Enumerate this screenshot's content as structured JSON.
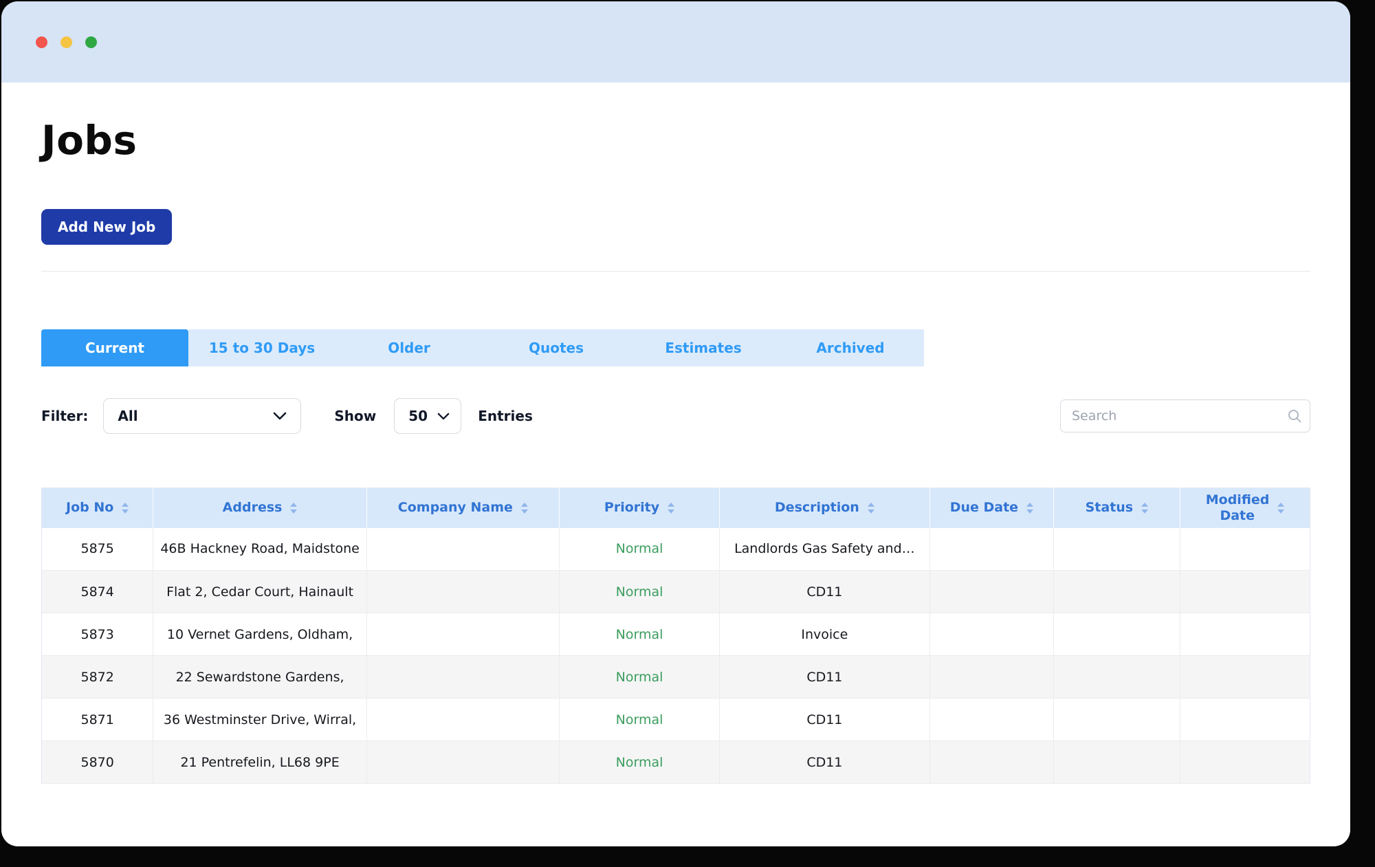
{
  "page": {
    "title": "Jobs",
    "add_button_label": "Add New Job"
  },
  "tabs": [
    {
      "label": "Current",
      "active": true
    },
    {
      "label": "15 to 30 Days",
      "active": false
    },
    {
      "label": "Older",
      "active": false
    },
    {
      "label": "Quotes",
      "active": false
    },
    {
      "label": "Estimates",
      "active": false
    },
    {
      "label": "Archived",
      "active": false
    }
  ],
  "filters": {
    "filter_label": "Filter:",
    "filter_value": "All",
    "show_label": "Show",
    "show_value": "50",
    "entries_label": "Entries",
    "search_placeholder": "Search"
  },
  "table": {
    "columns": [
      "Job No",
      "Address",
      "Company Name",
      "Priority",
      "Description",
      "Due Date",
      "Status",
      "Modified Date"
    ],
    "rows": [
      {
        "job_no": "5875",
        "address": "46B Hackney Road, Maidstone",
        "company": "",
        "priority": "Normal",
        "description": "Landlords Gas Safety and…",
        "due_date": "",
        "status": "",
        "modified": ""
      },
      {
        "job_no": "5874",
        "address": "Flat 2, Cedar Court, Hainault",
        "company": "",
        "priority": "Normal",
        "description": "CD11",
        "due_date": "",
        "status": "",
        "modified": ""
      },
      {
        "job_no": "5873",
        "address": "10 Vernet Gardens, Oldham,",
        "company": "",
        "priority": "Normal",
        "description": "Invoice",
        "due_date": "",
        "status": "",
        "modified": ""
      },
      {
        "job_no": "5872",
        "address": "22 Sewardstone Gardens,",
        "company": "",
        "priority": "Normal",
        "description": "CD11",
        "due_date": "",
        "status": "",
        "modified": ""
      },
      {
        "job_no": "5871",
        "address": "36 Westminster Drive, Wirral,",
        "company": "",
        "priority": "Normal",
        "description": "CD11",
        "due_date": "",
        "status": "",
        "modified": ""
      },
      {
        "job_no": "5870",
        "address": "21 Pentrefelin, LL68 9PE",
        "company": "",
        "priority": "Normal",
        "description": "CD11",
        "due_date": "",
        "status": "",
        "modified": ""
      }
    ]
  },
  "colors": {
    "accent_blue": "#2f9bf6",
    "tab_inactive_bg": "#dcebfc",
    "header_bg": "#d8e8fb",
    "header_text": "#3174d3",
    "add_button_bg": "#1e3ba8",
    "priority_normal": "#3a9d5d",
    "titlebar_bg": "#d6e4f6",
    "traffic_red": "#f2564d",
    "traffic_yellow": "#f6c443",
    "traffic_green": "#2fa844"
  }
}
